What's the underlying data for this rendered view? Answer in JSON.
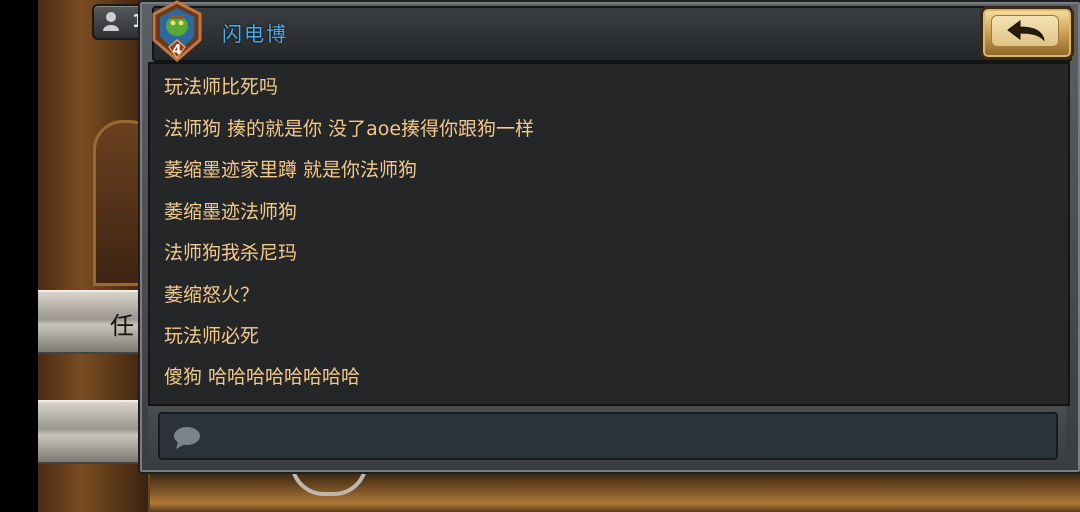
{
  "friends": {
    "count": "1",
    "icon": "person-icon"
  },
  "background": {
    "stone_bar_glyph": "任"
  },
  "chat": {
    "player_name": "闪电博",
    "player_rank": "4",
    "back_icon": "back-arrow-icon",
    "title_color": "#4fa8e8",
    "message_color": "#f2c98a",
    "messages": [
      "玩法师比死吗",
      "法师狗 揍的就是你 没了aoe揍得你跟狗一样",
      "萎缩墨迹家里蹲 就是你法师狗",
      "萎缩墨迹法师狗",
      "法师狗我杀尼玛",
      "萎缩怒火？",
      "玩法师必死",
      "傻狗 哈哈哈哈哈哈哈哈"
    ],
    "input": {
      "placeholder": "",
      "icon": "chat-bubble-icon"
    }
  }
}
